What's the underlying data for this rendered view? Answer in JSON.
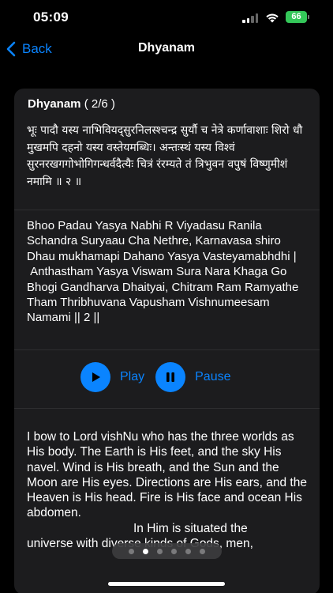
{
  "status_bar": {
    "time": "05:09",
    "battery": "66",
    "battery_color": "#34c759"
  },
  "nav": {
    "back_label": "Back",
    "title": "Dhyanam"
  },
  "card": {
    "title": "Dhyanam",
    "page_indicator": "( 2/6 )",
    "sanskrit": "भूः पादौ यस्य नाभिवियद्सुरनिलस्श्चन्द्र सुर्यौ च नेत्रे कर्णावाशाः शिरो धौ मुखमपि दहनो यस्य वस्तेयमब्धिः। अन्तःस्थं यस्य विश्वं सुरनरखगगोभोगिगन्धर्वदैत्यैः चित्रं रंरम्यते तं त्रिभुवन वपुषं विष्णुमीशं नमामि ॥ २ ॥",
    "transliteration": "Bhoo Padau Yasya Nabhi R Viyadasu Ranila Schandra Suryaau Cha Nethre, Karnavasa shiro Dhau mukhamapi Dahano Yasya Vasteyamabhdhi |  Anthastham Yasya Viswam Sura Nara Khaga Go Bhogi Gandharva Dhaityai, Chitram Ram Ramyathe Tham Thribhuvana Vapusham Vishnumeesam Namami || 2 ||",
    "english": "I bow to Lord vishNu who has the three worlds as His body. The Earth is His feet, and the sky His navel. Wind is His breath, and the Sun and the Moon are His eyes. Directions are His ears, and the Heaven is His head. Fire is His face and ocean His abdomen.",
    "english_partial_1": "... the universe with diverse kinds of Gods, men,",
    "english_fragment_a": "In Him is situated the",
    "english_fragment_b": "universe with diverse kinds of Gods, men,"
  },
  "controls": {
    "play_label": "Play",
    "pause_label": "Pause"
  },
  "pager": {
    "total": 6,
    "active": 2
  },
  "colors": {
    "accent": "#0a84ff",
    "card_bg": "#1c1c1e",
    "background": "#000000"
  },
  "icons": {
    "back": "chevron-left-icon",
    "play": "play-icon",
    "pause": "pause-icon",
    "signal": "cellular-signal-icon",
    "wifi": "wifi-icon",
    "battery": "battery-icon"
  }
}
